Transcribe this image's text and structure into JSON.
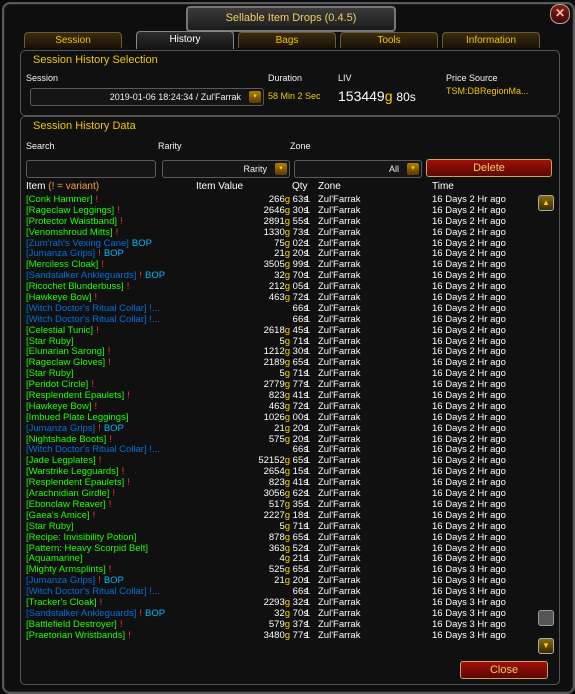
{
  "window": {
    "title": "Sellable Item Drops (0.4.5)",
    "close_glyph": "✕"
  },
  "tabs": [
    "Session",
    "History",
    "Bags",
    "Tools",
    "Information"
  ],
  "selection": {
    "title": "Session History Selection",
    "session_label": "Session",
    "session_value": "2019-01-06 18:24:34 / Zul'Farrak",
    "duration_label": "Duration",
    "duration_value": "58 Min 2 Sec",
    "liv_label": "LIV",
    "liv_gold": "153449",
    "liv_g": "g",
    "liv_silver": "80s",
    "price_label": "Price Source",
    "price_value": "TSM:DBRegionMa..."
  },
  "data_section": {
    "title": "Session History Data",
    "search_label": "Search",
    "search_value": "",
    "rarity_label": "Rarity",
    "rarity_value": "Rarity",
    "zone_label": "Zone",
    "zone_value": "All",
    "delete_label": "Delete"
  },
  "columns": {
    "item": "Item",
    "item_note": "(! = variant)",
    "value": "Item Value",
    "qty": "Qty",
    "zone": "Zone",
    "time": "Time"
  },
  "rows": [
    {
      "name": "[Conk Hammer]",
      "q": "uncommon",
      "bang": "!",
      "bop": "",
      "g": "266",
      "s": "63s",
      "qty": "1",
      "zone": "Zul'Farrak",
      "time": "16 Days 2 Hr ago"
    },
    {
      "name": "[Rageclaw Leggings]",
      "q": "uncommon",
      "bang": "!",
      "bop": "",
      "g": "2646",
      "s": "30s",
      "qty": "1",
      "zone": "Zul'Farrak",
      "time": "16 Days 2 Hr ago"
    },
    {
      "name": "[Protector Waistband]",
      "q": "uncommon",
      "bang": "!",
      "bop": "",
      "g": "2891",
      "s": "55s",
      "qty": "1",
      "zone": "Zul'Farrak",
      "time": "16 Days 2 Hr ago"
    },
    {
      "name": "[Venomshroud Mitts]",
      "q": "uncommon",
      "bang": "!",
      "bop": "",
      "g": "1330",
      "s": "73s",
      "qty": "1",
      "zone": "Zul'Farrak",
      "time": "16 Days 2 Hr ago"
    },
    {
      "name": "[Zum'rah's Vexing Cane]",
      "q": "rare",
      "bang": "",
      "bop": "BOP",
      "g": "75",
      "s": "02s",
      "qty": "1",
      "zone": "Zul'Farrak",
      "time": "16 Days 2 Hr ago"
    },
    {
      "name": "[Jumanza Grips]",
      "q": "rare",
      "bang": "!",
      "bop": "BOP",
      "g": "21",
      "s": "20s",
      "qty": "1",
      "zone": "Zul'Farrak",
      "time": "16 Days 2 Hr ago"
    },
    {
      "name": "[Merciless Cloak]",
      "q": "uncommon",
      "bang": "!",
      "bop": "",
      "g": "3505",
      "s": "99s",
      "qty": "1",
      "zone": "Zul'Farrak",
      "time": "16 Days 2 Hr ago"
    },
    {
      "name": "[Sandstalker Ankleguards]",
      "q": "rare",
      "bang": "!",
      "bop": "BOP",
      "g": "32",
      "s": "70s",
      "qty": "1",
      "zone": "Zul'Farrak",
      "time": "16 Days 2 Hr ago"
    },
    {
      "name": "[Ricochet Blunderbuss]",
      "q": "uncommon",
      "bang": "!",
      "bop": "",
      "g": "212",
      "s": "05s",
      "qty": "1",
      "zone": "Zul'Farrak",
      "time": "16 Days 2 Hr ago"
    },
    {
      "name": "[Hawkeye Bow]",
      "q": "uncommon",
      "bang": "!",
      "bop": "",
      "g": "463",
      "s": "72s",
      "qty": "1",
      "zone": "Zul'Farrak",
      "time": "16 Days 2 Hr ago"
    },
    {
      "name": "[Witch Doctor's Ritual Collar] !...",
      "q": "rare",
      "bang": "",
      "bop": "",
      "g": "",
      "s": "66s",
      "qty": "1",
      "zone": "Zul'Farrak",
      "time": "16 Days 2 Hr ago"
    },
    {
      "name": "[Witch Doctor's Ritual Collar] !...",
      "q": "rare",
      "bang": "",
      "bop": "",
      "g": "",
      "s": "66s",
      "qty": "1",
      "zone": "Zul'Farrak",
      "time": "16 Days 2 Hr ago"
    },
    {
      "name": "[Celestial Tunic]",
      "q": "uncommon",
      "bang": "!",
      "bop": "",
      "g": "2618",
      "s": "45s",
      "qty": "1",
      "zone": "Zul'Farrak",
      "time": "16 Days 2 Hr ago"
    },
    {
      "name": "[Star Ruby]",
      "q": "uncommon",
      "bang": "",
      "bop": "",
      "g": "5",
      "s": "71s",
      "qty": "1",
      "zone": "Zul'Farrak",
      "time": "16 Days 2 Hr ago"
    },
    {
      "name": "[Elunarian Sarong]",
      "q": "uncommon",
      "bang": "!",
      "bop": "",
      "g": "1212",
      "s": "30s",
      "qty": "1",
      "zone": "Zul'Farrak",
      "time": "16 Days 2 Hr ago"
    },
    {
      "name": "[Rageclaw Gloves]",
      "q": "uncommon",
      "bang": "!",
      "bop": "",
      "g": "2189",
      "s": "65s",
      "qty": "1",
      "zone": "Zul'Farrak",
      "time": "16 Days 2 Hr ago"
    },
    {
      "name": "[Star Ruby]",
      "q": "uncommon",
      "bang": "",
      "bop": "",
      "g": "5",
      "s": "71s",
      "qty": "1",
      "zone": "Zul'Farrak",
      "time": "16 Days 2 Hr ago"
    },
    {
      "name": "[Peridot Circle]",
      "q": "uncommon",
      "bang": "!",
      "bop": "",
      "g": "2779",
      "s": "77s",
      "qty": "1",
      "zone": "Zul'Farrak",
      "time": "16 Days 2 Hr ago"
    },
    {
      "name": "[Resplendent Epaulets]",
      "q": "uncommon",
      "bang": "!",
      "bop": "",
      "g": "823",
      "s": "41s",
      "qty": "1",
      "zone": "Zul'Farrak",
      "time": "16 Days 2 Hr ago"
    },
    {
      "name": "[Hawkeye Bow]",
      "q": "uncommon",
      "bang": "!",
      "bop": "",
      "g": "463",
      "s": "72s",
      "qty": "1",
      "zone": "Zul'Farrak",
      "time": "16 Days 2 Hr ago"
    },
    {
      "name": "[Imbued Plate Leggings]",
      "q": "uncommon",
      "bang": "",
      "bop": "",
      "g": "1026",
      "s": "00s",
      "qty": "1",
      "zone": "Zul'Farrak",
      "time": "16 Days 2 Hr ago"
    },
    {
      "name": "[Jumanza Grips]",
      "q": "rare",
      "bang": "!",
      "bop": "BOP",
      "g": "21",
      "s": "20s",
      "qty": "1",
      "zone": "Zul'Farrak",
      "time": "16 Days 2 Hr ago"
    },
    {
      "name": "[Nightshade Boots]",
      "q": "uncommon",
      "bang": "!",
      "bop": "",
      "g": "575",
      "s": "20s",
      "qty": "1",
      "zone": "Zul'Farrak",
      "time": "16 Days 2 Hr ago"
    },
    {
      "name": "[Witch Doctor's Ritual Collar] !...",
      "q": "rare",
      "bang": "",
      "bop": "",
      "g": "",
      "s": "66s",
      "qty": "1",
      "zone": "Zul'Farrak",
      "time": "16 Days 2 Hr ago"
    },
    {
      "name": "[Jade Legplates]",
      "q": "uncommon",
      "bang": "!",
      "bop": "",
      "g": "52152",
      "s": "65s",
      "qty": "1",
      "zone": "Zul'Farrak",
      "time": "16 Days 2 Hr ago"
    },
    {
      "name": "[Warstrike Legguards]",
      "q": "uncommon",
      "bang": "!",
      "bop": "",
      "g": "2654",
      "s": "15s",
      "qty": "1",
      "zone": "Zul'Farrak",
      "time": "16 Days 2 Hr ago"
    },
    {
      "name": "[Resplendent Epaulets]",
      "q": "uncommon",
      "bang": "!",
      "bop": "",
      "g": "823",
      "s": "41s",
      "qty": "1",
      "zone": "Zul'Farrak",
      "time": "16 Days 2 Hr ago"
    },
    {
      "name": "[Arachnidian Girdle]",
      "q": "uncommon",
      "bang": "!",
      "bop": "",
      "g": "3056",
      "s": "62s",
      "qty": "1",
      "zone": "Zul'Farrak",
      "time": "16 Days 2 Hr ago"
    },
    {
      "name": "[Ebonclaw Reaver]",
      "q": "uncommon",
      "bang": "!",
      "bop": "",
      "g": "517",
      "s": "35s",
      "qty": "1",
      "zone": "Zul'Farrak",
      "time": "16 Days 2 Hr ago"
    },
    {
      "name": "[Gaea's Amice]",
      "q": "uncommon",
      "bang": "!",
      "bop": "",
      "g": "2227",
      "s": "18s",
      "qty": "1",
      "zone": "Zul'Farrak",
      "time": "16 Days 2 Hr ago"
    },
    {
      "name": "[Star Ruby]",
      "q": "uncommon",
      "bang": "",
      "bop": "",
      "g": "5",
      "s": "71s",
      "qty": "1",
      "zone": "Zul'Farrak",
      "time": "16 Days 2 Hr ago"
    },
    {
      "name": "[Recipe: Invisibility Potion]",
      "q": "uncommon",
      "bang": "",
      "bop": "",
      "g": "878",
      "s": "65s",
      "qty": "1",
      "zone": "Zul'Farrak",
      "time": "16 Days 2 Hr ago"
    },
    {
      "name": "[Pattern: Heavy Scorpid Belt]",
      "q": "uncommon",
      "bang": "",
      "bop": "",
      "g": "363",
      "s": "52s",
      "qty": "1",
      "zone": "Zul'Farrak",
      "time": "16 Days 2 Hr ago"
    },
    {
      "name": "[Aquamarine]",
      "q": "uncommon",
      "bang": "",
      "bop": "",
      "g": "4",
      "s": "21s",
      "qty": "1",
      "zone": "Zul'Farrak",
      "time": "16 Days 2 Hr ago"
    },
    {
      "name": "[Mighty Armsplints]",
      "q": "uncommon",
      "bang": "!",
      "bop": "",
      "g": "525",
      "s": "65s",
      "qty": "1",
      "zone": "Zul'Farrak",
      "time": "16 Days 3 Hr ago"
    },
    {
      "name": "[Jumanza Grips]",
      "q": "rare",
      "bang": "!",
      "bop": "BOP",
      "g": "21",
      "s": "20s",
      "qty": "1",
      "zone": "Zul'Farrak",
      "time": "16 Days 3 Hr ago"
    },
    {
      "name": "[Witch Doctor's Ritual Collar] !...",
      "q": "rare",
      "bang": "",
      "bop": "",
      "g": "",
      "s": "66s",
      "qty": "1",
      "zone": "Zul'Farrak",
      "time": "16 Days 3 Hr ago"
    },
    {
      "name": "[Tracker's Cloak]",
      "q": "uncommon",
      "bang": "!",
      "bop": "",
      "g": "2293",
      "s": "32s",
      "qty": "1",
      "zone": "Zul'Farrak",
      "time": "16 Days 3 Hr ago"
    },
    {
      "name": "[Sandstalker Ankleguards]",
      "q": "rare",
      "bang": "!",
      "bop": "BOP",
      "g": "32",
      "s": "70s",
      "qty": "1",
      "zone": "Zul'Farrak",
      "time": "16 Days 3 Hr ago"
    },
    {
      "name": "[Battlefield Destroyer]",
      "q": "uncommon",
      "bang": "!",
      "bop": "",
      "g": "579",
      "s": "37s",
      "qty": "1",
      "zone": "Zul'Farrak",
      "time": "16 Days 3 Hr ago"
    },
    {
      "name": "[Praetorian Wristbands]",
      "q": "uncommon",
      "bang": "!",
      "bop": "",
      "g": "3480",
      "s": "77s",
      "qty": "1",
      "zone": "Zul'Farrak",
      "time": "16 Days 3 Hr ago"
    }
  ],
  "close_label": "Close",
  "icons": {
    "arrow": "▾",
    "up": "▲",
    "down": "▼"
  }
}
